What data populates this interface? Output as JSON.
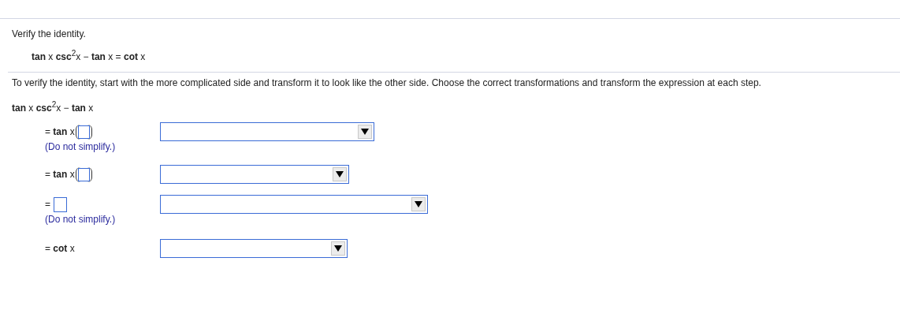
{
  "prompt": "Verify the identity.",
  "identity": "**tan** x **csc**$^{2}$x − **tan** x = **cot** x",
  "instruction": "To verify the identity, start with the more complicated side and transform it to look like the other side. Choose the correct transformations and transform the expression at each step.",
  "start_expression": "**tan** x **csc**$^{2}$x − **tan** x",
  "steps": [
    {
      "kind": "paren-box",
      "prefix": "= **tan** x",
      "hint": "(Do not simplify.)"
    },
    {
      "kind": "paren-box",
      "prefix": "= **tan** x"
    },
    {
      "kind": "box",
      "prefix": "=",
      "hint": "(Do not simplify.)"
    },
    {
      "kind": "plain",
      "prefix": "= **cot** x"
    }
  ]
}
